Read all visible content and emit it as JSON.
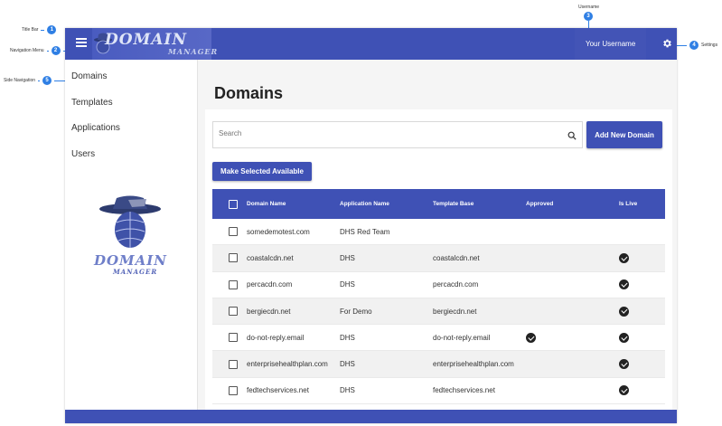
{
  "annotations": {
    "title_bar": {
      "num": "1",
      "label": "Title Bar"
    },
    "navigation_menu": {
      "num": "2",
      "label": "Navigation Menu"
    },
    "username": {
      "num": "3",
      "label": "Username"
    },
    "settings": {
      "num": "4",
      "label": "Settings"
    },
    "side_navigation": {
      "num": "5",
      "label": "Side Navigation"
    }
  },
  "header": {
    "logo_main": "DOMAIN",
    "logo_sub": "MANAGER",
    "username": "Your Username",
    "menu_icon": "hamburger-menu-icon",
    "settings_icon": "gear-icon"
  },
  "sidebar": {
    "items": [
      {
        "label": "Domains"
      },
      {
        "label": "Templates"
      },
      {
        "label": "Applications"
      },
      {
        "label": "Users"
      }
    ],
    "logo_main": "DOMAIN",
    "logo_sub": "MANAGER"
  },
  "main": {
    "title": "Domains",
    "search_placeholder": "Search",
    "add_button": "Add New Domain",
    "make_available_button": "Make Selected Available"
  },
  "table": {
    "columns": [
      "Domain Name",
      "Application Name",
      "Template Base",
      "Approved",
      "Is Live"
    ],
    "rows": [
      {
        "domain": "somedemotest.com",
        "app": "DHS Red Team",
        "template": "",
        "approved": false,
        "live": false
      },
      {
        "domain": "coastalcdn.net",
        "app": "DHS",
        "template": "coastalcdn.net",
        "approved": false,
        "live": true
      },
      {
        "domain": "percacdn.com",
        "app": "DHS",
        "template": "percacdn.com",
        "approved": false,
        "live": true
      },
      {
        "domain": "bergiecdn.net",
        "app": "For Demo",
        "template": "bergiecdn.net",
        "approved": false,
        "live": true
      },
      {
        "domain": "do-not-reply.email",
        "app": "DHS",
        "template": "do-not-reply.email",
        "approved": true,
        "live": true
      },
      {
        "domain": "enterprisehealthplan.com",
        "app": "DHS",
        "template": "enterprisehealthplan.com",
        "approved": false,
        "live": true
      },
      {
        "domain": "fedtechservices.net",
        "app": "DHS",
        "template": "fedtechservices.net",
        "approved": false,
        "live": true
      }
    ]
  },
  "colors": {
    "primary": "#3f51b5",
    "callout": "#2f7fe4"
  }
}
